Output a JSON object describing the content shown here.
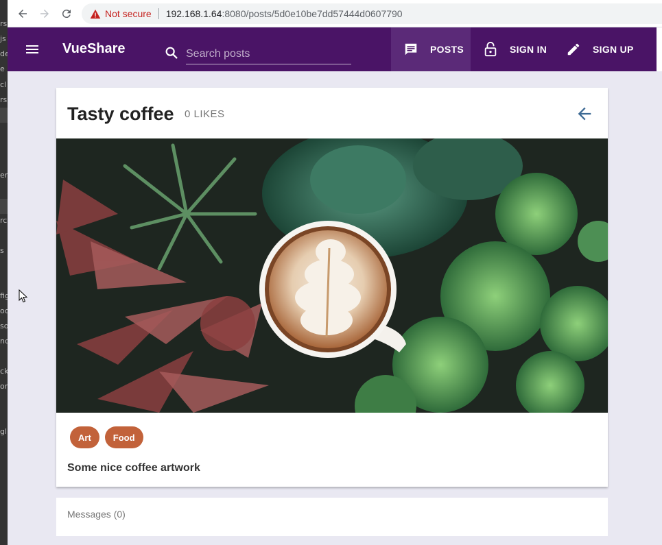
{
  "browser": {
    "security_label": "Not secure",
    "url_host": "192.168.1.64",
    "url_path": ":8080/posts/5d0e10be7dd57444d0607790"
  },
  "appbar": {
    "brand": "VueShare",
    "search_placeholder": "Search posts",
    "nav": {
      "posts": "POSTS",
      "sign_in": "SIGN IN",
      "sign_up": "SIGN UP"
    }
  },
  "post": {
    "title": "Tasty coffee",
    "likes": "0 LIKES",
    "categories": [
      "Art",
      "Food"
    ],
    "description": "Some nice coffee artwork"
  },
  "messages": {
    "title": "Messages (0)"
  },
  "colors": {
    "appbar": "#4a1466",
    "active_nav": "#5b2a78",
    "chip": "#c2623a",
    "back_arrow": "#3d6a94",
    "page_bg": "#e9e8f2"
  },
  "icons": {
    "menu": "menu-icon",
    "search": "search-icon",
    "posts": "chat-icon",
    "sign_in": "lock-open-icon",
    "sign_up": "pencil-icon",
    "back": "arrow-left-icon"
  }
}
